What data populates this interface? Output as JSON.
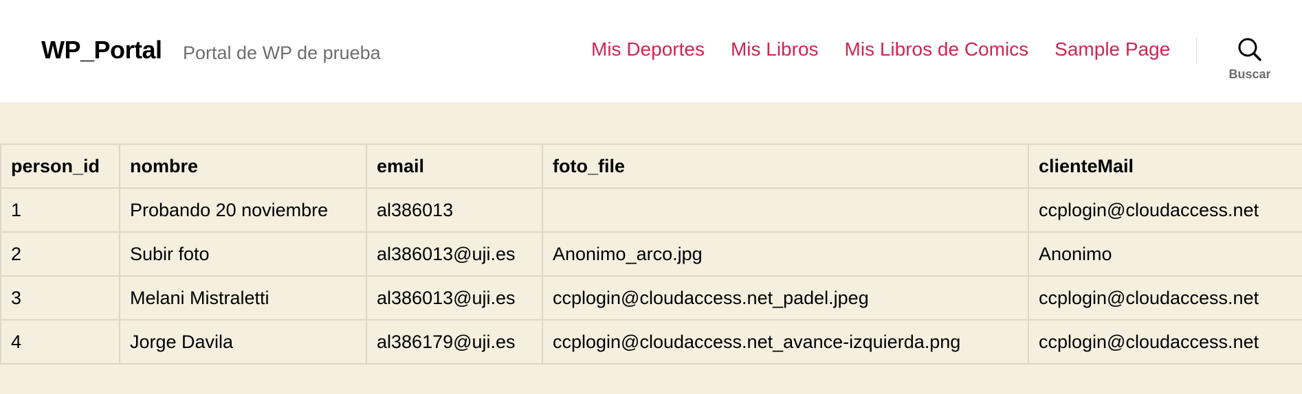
{
  "site": {
    "title": "WP_Portal",
    "description": "Portal de WP de prueba"
  },
  "nav": {
    "items": [
      "Mis Deportes",
      "Mis Libros",
      "Mis Libros de Comics",
      "Sample Page"
    ],
    "color": "#cd2653"
  },
  "search": {
    "icon": "search-icon",
    "label": "Buscar"
  },
  "table": {
    "headers": [
      "person_id",
      "nombre",
      "email",
      "foto_file",
      "clienteMail"
    ],
    "rows": [
      [
        "1",
        "Probando 20 noviembre",
        "al386013",
        "",
        "ccplogin@cloudaccess.net"
      ],
      [
        "2",
        "Subir foto",
        "al386013@uji.es",
        "Anonimo_arco.jpg",
        "Anonimo"
      ],
      [
        "3",
        "Melani Mistraletti",
        "al386013@uji.es",
        "ccplogin@cloudaccess.net_padel.jpeg",
        "ccplogin@cloudaccess.net"
      ],
      [
        "4",
        "Jorge Davila",
        "al386179@uji.es",
        "ccplogin@cloudaccess.net_avance-izquierda.png",
        "ccplogin@cloudaccess.net"
      ]
    ]
  },
  "colors": {
    "background": "#f5efe0",
    "header_background": "#ffffff",
    "accent": "#cd2653"
  }
}
